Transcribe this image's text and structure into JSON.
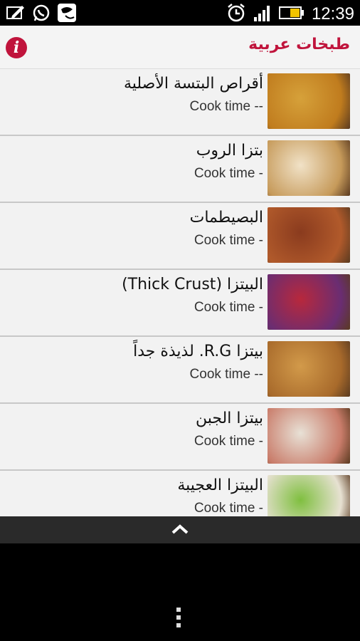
{
  "status": {
    "time": "12:39",
    "icons": [
      "notification-icon",
      "whatsapp-icon",
      "chat-icon",
      "alarm-icon",
      "signal-icon",
      "battery-icon"
    ]
  },
  "app": {
    "title": "طبخات عربية",
    "accent": "#c0143c"
  },
  "recipes": [
    {
      "title": "أقراص البتسة الأصلية",
      "cook": "Cook time --",
      "thumb_colors": [
        "#d6a13a",
        "#c07c1e"
      ]
    },
    {
      "title": "بتزا الروب",
      "cook": "Cook time -",
      "thumb_colors": [
        "#f1e2c7",
        "#c69a5a"
      ]
    },
    {
      "title": "البصيطمات",
      "cook": "Cook time -",
      "thumb_colors": [
        "#8a3b1e",
        "#b15a2b"
      ]
    },
    {
      "title": "البيتزا (Thick Crust)",
      "cook": "Cook time -",
      "thumb_colors": [
        "#b8283c",
        "#6a2d72"
      ]
    },
    {
      "title": "بيتزا R.G. لذيذة جداً",
      "cook": "Cook time --",
      "thumb_colors": [
        "#d29a4a",
        "#a86a2b"
      ]
    },
    {
      "title": "بيتزا الجبن",
      "cook": "Cook time -",
      "thumb_colors": [
        "#e8e1d6",
        "#c97c6a"
      ]
    },
    {
      "title": "البيتزا العجيبة",
      "cook": "Cook time -",
      "thumb_colors": [
        "#7fbf3f",
        "#e7e1d2"
      ]
    }
  ]
}
